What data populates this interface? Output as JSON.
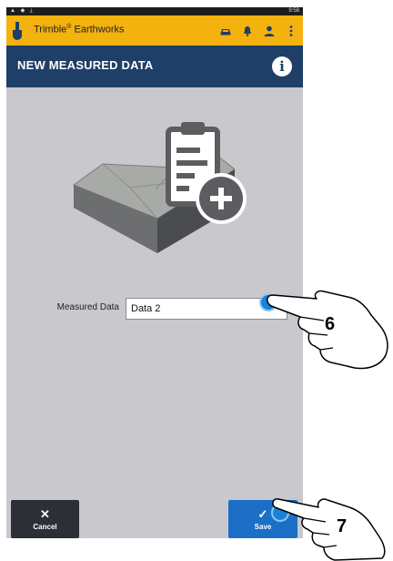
{
  "status_bar": {
    "left_icons": "▲ ◆ ⤓",
    "time": "9:58"
  },
  "app_bar": {
    "title": "Trimble",
    "title_mark": "®",
    "title_suffix": " Earthworks",
    "icons": [
      "vehicle-icon",
      "bell-icon",
      "user-icon",
      "more-vert-icon"
    ]
  },
  "header": {
    "title": "NEW MEASURED DATA",
    "info_icon": "i"
  },
  "form": {
    "label": "Measured Data",
    "value": "Data 2"
  },
  "buttons": {
    "cancel": {
      "glyph": "✕",
      "label": "Cancel"
    },
    "save": {
      "glyph": "✓",
      "label": "Save"
    }
  },
  "callouts": {
    "step_6": "6",
    "step_7": "7"
  },
  "colors": {
    "app_bar": "#f3b20d",
    "header": "#1e3f68",
    "save": "#1c6fc6",
    "cancel": "#2c2f36",
    "body": "#c9c9cd"
  }
}
